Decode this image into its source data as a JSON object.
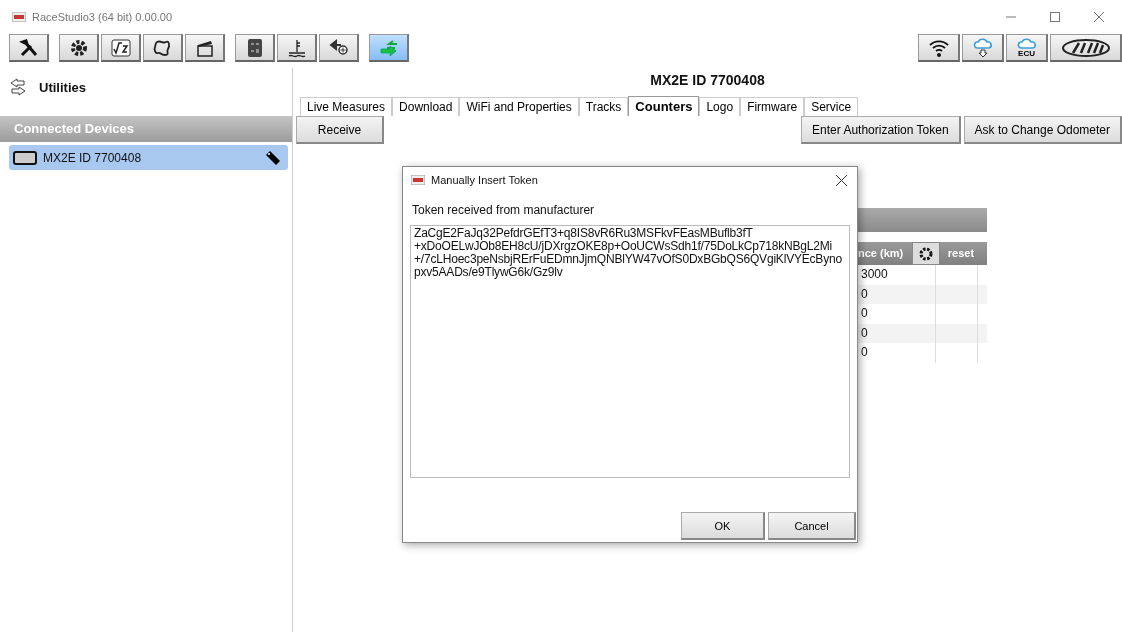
{
  "window": {
    "title": "RaceStudio3 (64 bit) 0.00.00"
  },
  "toolbar": {
    "groups": [
      [
        {
          "selected": false
        }
      ],
      [
        {
          "selected": false
        },
        {
          "selected": false
        },
        {
          "selected": false
        },
        {
          "selected": false
        }
      ],
      [
        {
          "selected": false
        },
        {
          "selected": false
        },
        {
          "selected": false
        }
      ],
      [
        {
          "selected": true
        }
      ]
    ],
    "ecu_label": "ECU"
  },
  "sidebar": {
    "title": "Utilities",
    "section": "Connected Devices",
    "devices": [
      {
        "name": "MX2E ID 7700408",
        "selected": true
      }
    ]
  },
  "device_title": "MX2E ID 7700408",
  "tabs": [
    {
      "label": "Live Measures",
      "selected": false
    },
    {
      "label": "Download",
      "selected": false
    },
    {
      "label": "WiFi and Properties",
      "selected": false
    },
    {
      "label": "Tracks",
      "selected": false
    },
    {
      "label": "Counters",
      "selected": true
    },
    {
      "label": "Logo",
      "selected": false
    },
    {
      "label": "Firmware",
      "selected": false
    },
    {
      "label": "Service",
      "selected": false
    }
  ],
  "actions": {
    "left": "Receive",
    "right": [
      "Enter Authorization Token",
      "Ask to Change Odometer"
    ]
  },
  "table": {
    "columns": [
      "nce (km)",
      "reset"
    ],
    "rows": [
      "3000",
      "0",
      "0",
      "0",
      "0"
    ]
  },
  "dialog": {
    "title": "Manually Insert Token",
    "label": "Token received from manufacturer",
    "token_lines": [
      "ZaCgE2FaJq32PefdrGEfT3+q8IS8vR6Ru3MSFkvFEasMBuflb3fT",
      "+xDoOELwJOb8EH8cU/jDXrgzOKE8p+OoUCWsSdh1f/75DoLkCp718kNBgL2Mi",
      "+/7cLHoec3peNsbjRErFuEDmnJjmQNBlYW47vOfS0DxBGbQS6QVgiKlVYEcByno",
      "pxv5AADs/e9TlywG6k/Gz9lv"
    ],
    "buttons": [
      "OK",
      "Cancel"
    ]
  }
}
